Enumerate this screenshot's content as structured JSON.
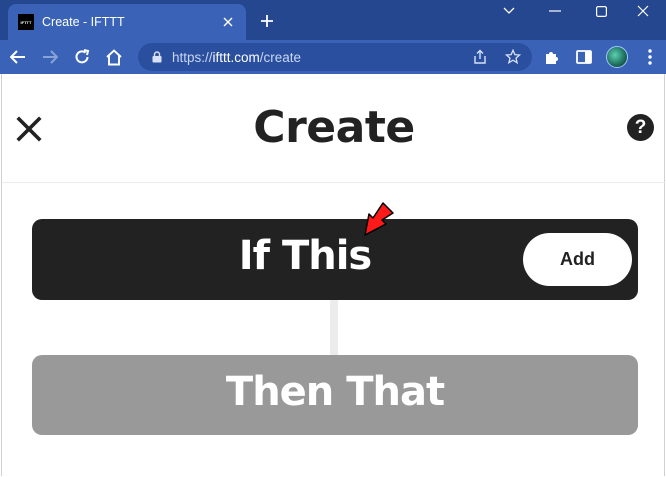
{
  "browser": {
    "tab": {
      "favicon_text": "IFTTT",
      "title": "Create - IFTTT"
    },
    "url": {
      "scheme": "https://",
      "host": "ifttt.com",
      "path": "/create"
    },
    "icons": {
      "tab_close": "close-icon",
      "new_tab": "plus-icon",
      "minimize": "minimize-icon",
      "maximize": "maximize-icon",
      "window_close": "close-icon",
      "collapse": "chevron-down-icon",
      "back": "arrow-left-icon",
      "forward": "arrow-right-icon",
      "reload": "reload-icon",
      "home": "home-icon",
      "lock": "lock-icon",
      "share": "share-icon",
      "bookmark": "star-icon",
      "extensions": "puzzle-icon",
      "side_panel": "side-panel-icon",
      "profile": "avatar"
    }
  },
  "page": {
    "title": "Create",
    "help_label": "?",
    "if_block": {
      "label": "If This",
      "add_label": "Add"
    },
    "then_block": {
      "label": "Then That"
    }
  },
  "colors": {
    "chrome_dark": "#24478f",
    "chrome_tab": "#3a63b8",
    "if_block": "#222222",
    "then_block": "#999999",
    "annotation_arrow": "#ff0000"
  }
}
